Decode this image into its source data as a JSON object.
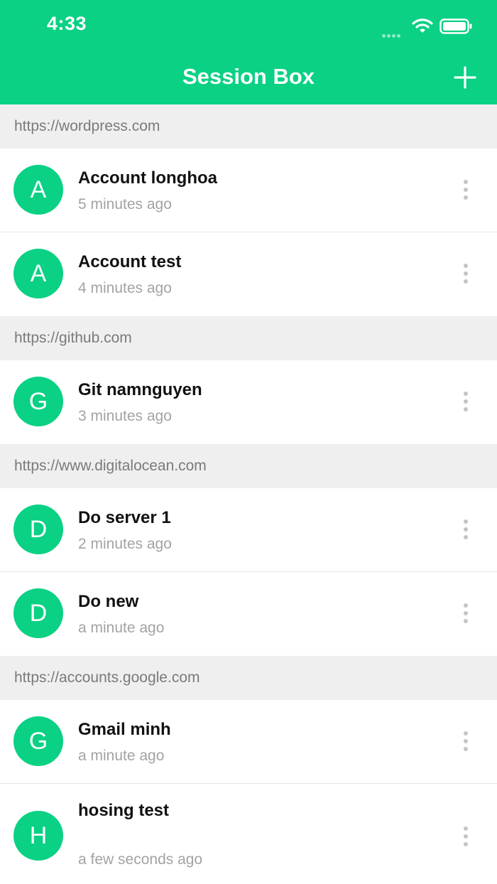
{
  "status_bar": {
    "time": "4:33"
  },
  "nav": {
    "title": "Session Box",
    "add_icon": "plus-icon"
  },
  "colors": {
    "accent": "#0ad184",
    "section_bg": "#efefef",
    "subtext": "#a3a3a3"
  },
  "sections": [
    {
      "url": "https://wordpress.com",
      "items": [
        {
          "initial": "A",
          "title": "Account longhoa",
          "time": "5 minutes ago"
        },
        {
          "initial": "A",
          "title": "Account test",
          "time": "4 minutes ago"
        }
      ]
    },
    {
      "url": "https://github.com",
      "items": [
        {
          "initial": "G",
          "title": "Git namnguyen",
          "time": "3 minutes ago"
        }
      ]
    },
    {
      "url": "https://www.digitalocean.com",
      "items": [
        {
          "initial": "D",
          "title": "Do server 1",
          "time": "2 minutes ago"
        },
        {
          "initial": "D",
          "title": "Do new",
          "time": "a minute ago"
        }
      ]
    },
    {
      "url": "https://accounts.google.com",
      "items": [
        {
          "initial": "G",
          "title": "Gmail minh",
          "time": "a minute ago"
        },
        {
          "initial": "H",
          "title": "hosing test",
          "time": "a few seconds ago"
        }
      ]
    }
  ]
}
